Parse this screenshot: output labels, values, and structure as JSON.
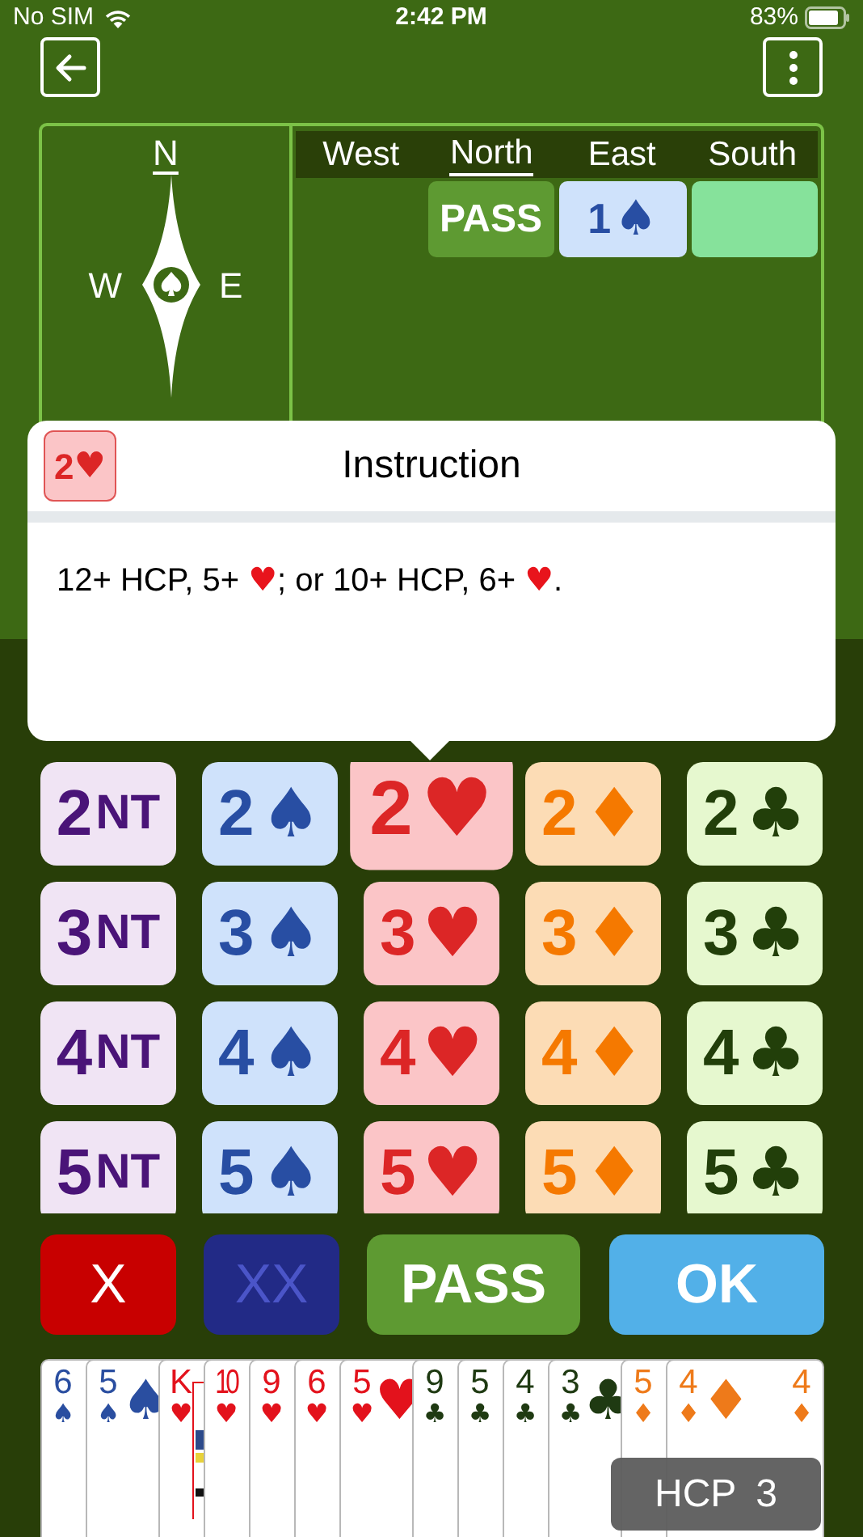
{
  "status_bar": {
    "carrier": "No SIM",
    "time": "2:42 PM",
    "battery": "83%"
  },
  "compass": {
    "points": [
      {
        "label": "N",
        "selected": true
      },
      {
        "label": "W",
        "selected": false
      },
      {
        "label": "E",
        "selected": false
      }
    ]
  },
  "auction": {
    "columns": [
      {
        "label": "West",
        "selected": false
      },
      {
        "label": "North",
        "selected": true
      },
      {
        "label": "East",
        "selected": false
      },
      {
        "label": "South",
        "selected": false
      }
    ],
    "bids": [
      {
        "kind": "empty"
      },
      {
        "kind": "pass",
        "text": "PASS"
      },
      {
        "kind": "spades",
        "level": "1",
        "suit": "♠"
      },
      {
        "kind": "current"
      }
    ]
  },
  "instruction": {
    "badge": {
      "level": "2",
      "suit": "♥",
      "kind": "hearts"
    },
    "title": "Instruction",
    "text": [
      {
        "kind": "plain",
        "text": "12+ HCP, 5+ "
      },
      {
        "kind": "hearts",
        "text": "♥"
      },
      {
        "kind": "plain",
        "text": "; or 10+ HCP, 6+ "
      },
      {
        "kind": "hearts",
        "text": "♥"
      },
      {
        "kind": "plain",
        "text": "."
      }
    ]
  },
  "bid_grid": [
    [
      {
        "level": "2",
        "suit": "NT",
        "kind": "nt",
        "selected": false
      },
      {
        "level": "2",
        "suit": "♠",
        "kind": "spades",
        "selected": false
      },
      {
        "level": "2",
        "suit": "♥",
        "kind": "hearts",
        "selected": true
      },
      {
        "level": "2",
        "suit": "♦",
        "kind": "diamonds",
        "selected": false
      },
      {
        "level": "2",
        "suit": "♣",
        "kind": "clubs",
        "selected": false
      }
    ],
    [
      {
        "level": "3",
        "suit": "NT",
        "kind": "nt",
        "selected": false
      },
      {
        "level": "3",
        "suit": "♠",
        "kind": "spades",
        "selected": false
      },
      {
        "level": "3",
        "suit": "♥",
        "kind": "hearts",
        "selected": false
      },
      {
        "level": "3",
        "suit": "♦",
        "kind": "diamonds",
        "selected": false
      },
      {
        "level": "3",
        "suit": "♣",
        "kind": "clubs",
        "selected": false
      }
    ],
    [
      {
        "level": "4",
        "suit": "NT",
        "kind": "nt",
        "selected": false
      },
      {
        "level": "4",
        "suit": "♠",
        "kind": "spades",
        "selected": false
      },
      {
        "level": "4",
        "suit": "♥",
        "kind": "hearts",
        "selected": false
      },
      {
        "level": "4",
        "suit": "♦",
        "kind": "diamonds",
        "selected": false
      },
      {
        "level": "4",
        "suit": "♣",
        "kind": "clubs",
        "selected": false
      }
    ],
    [
      {
        "level": "5",
        "suit": "NT",
        "kind": "nt",
        "selected": false
      },
      {
        "level": "5",
        "suit": "♠",
        "kind": "spades",
        "selected": false
      },
      {
        "level": "5",
        "suit": "♥",
        "kind": "hearts",
        "selected": false
      },
      {
        "level": "5",
        "suit": "♦",
        "kind": "diamonds",
        "selected": false
      },
      {
        "level": "5",
        "suit": "♣",
        "kind": "clubs",
        "selected": false
      }
    ]
  ],
  "actions": [
    {
      "kind": "double",
      "label": "X",
      "disabled": false
    },
    {
      "kind": "redouble",
      "label": "XX",
      "disabled": true
    },
    {
      "kind": "pass",
      "label": "PASS",
      "disabled": false
    },
    {
      "kind": "ok",
      "label": "OK",
      "disabled": false
    }
  ],
  "hand": [
    {
      "rank": "6",
      "suit": "♠",
      "kind": "spades"
    },
    {
      "rank": "5",
      "suit": "♠",
      "kind": "spades"
    },
    {
      "rank": "K",
      "suit": "♥",
      "kind": "hearts",
      "face": true
    },
    {
      "rank": "10",
      "suit": "♥",
      "kind": "hearts"
    },
    {
      "rank": "9",
      "suit": "♥",
      "kind": "hearts"
    },
    {
      "rank": "6",
      "suit": "♥",
      "kind": "hearts"
    },
    {
      "rank": "5",
      "suit": "♥",
      "kind": "hearts"
    },
    {
      "rank": "9",
      "suit": "♣",
      "kind": "clubs"
    },
    {
      "rank": "5",
      "suit": "♣",
      "kind": "clubs"
    },
    {
      "rank": "4",
      "suit": "♣",
      "kind": "clubs"
    },
    {
      "rank": "3",
      "suit": "♣",
      "kind": "clubs"
    },
    {
      "rank": "5",
      "suit": "♦",
      "kind": "diamonds"
    },
    {
      "rank": "4",
      "suit": "♦",
      "kind": "diamonds",
      "corner_rank": "4"
    }
  ],
  "hcp": {
    "label": "HCP",
    "value": "3"
  }
}
